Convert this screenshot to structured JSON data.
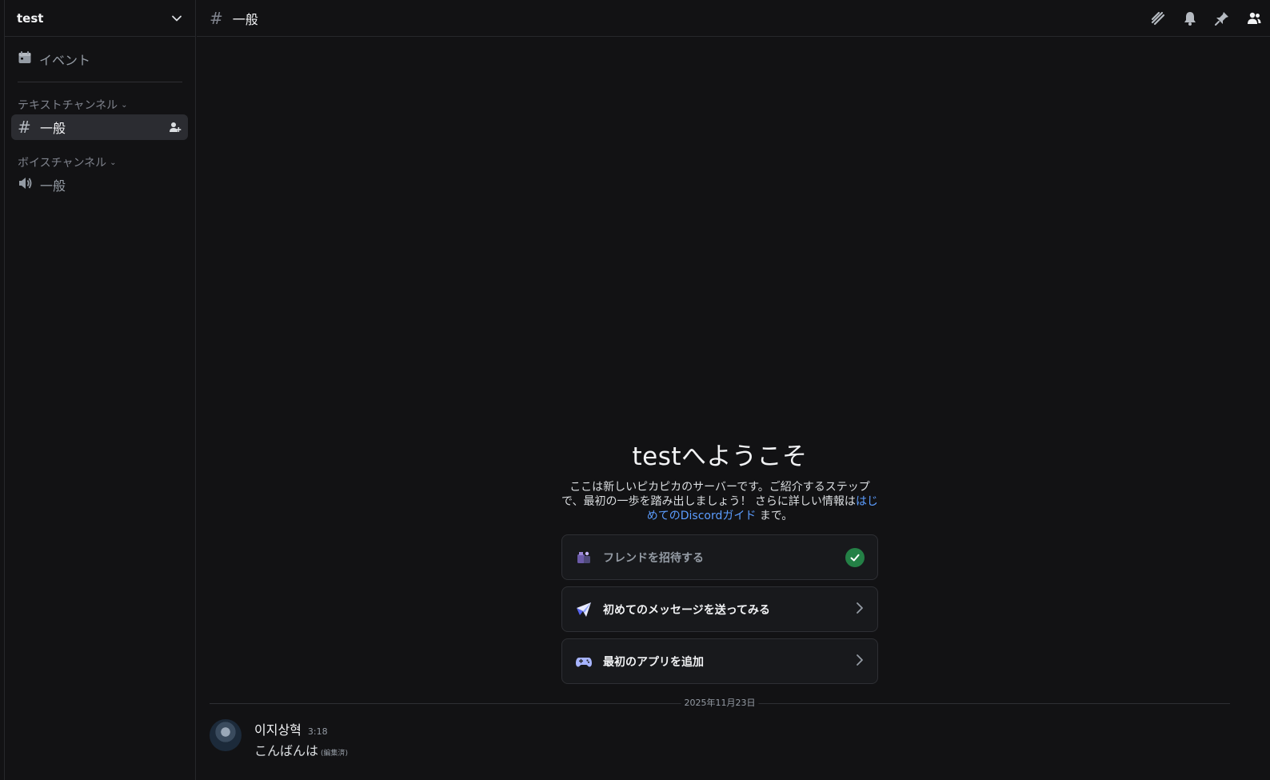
{
  "server": {
    "name": "test"
  },
  "sidebar": {
    "events_label": "イベント",
    "text_category": "テキストチャンネル",
    "text_channels": [
      {
        "name": "一般"
      }
    ],
    "voice_category": "ボイスチャンネル",
    "voice_channels": [
      {
        "name": "一般"
      }
    ]
  },
  "topbar": {
    "hash": "#",
    "channel_name": "一般"
  },
  "welcome": {
    "title": "testへようこそ",
    "desc_pre": "ここは新しいピカピカのサーバーです。ご紹介するステップで、最初の一歩を踏み出しましょう！ さらに詳しい情報は",
    "desc_link": "はじめてのDiscordガイド",
    "desc_post": "まで。"
  },
  "cards": [
    {
      "label": "フレンドを招待する",
      "icon": "invite-friends-icon",
      "done": true
    },
    {
      "label": "初めてのメッセージを送ってみる",
      "icon": "paper-plane-icon",
      "done": false
    },
    {
      "label": "最初のアプリを追加",
      "icon": "gamepad-icon",
      "done": false
    }
  ],
  "date_divider": "2025年11月23日",
  "message": {
    "author": "이지상혁",
    "time": "3:18",
    "text": "こんばんは",
    "edited": "(編集済)"
  },
  "colors": {
    "background": "#121214",
    "active_channel": "#2b2c31",
    "link": "#5c9dff",
    "check_green": "#248046"
  }
}
